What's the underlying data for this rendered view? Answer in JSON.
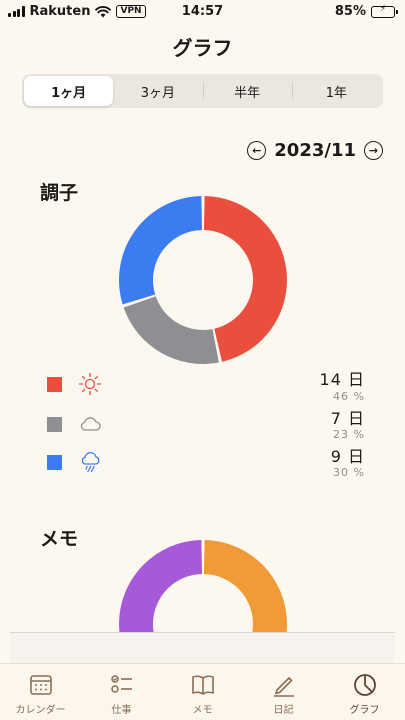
{
  "status_bar": {
    "carrier": "Rakuten",
    "vpn": "VPN",
    "time": "14:57",
    "battery": "85%"
  },
  "title": "グラフ",
  "segments": [
    {
      "label": "1ヶ月",
      "active": true
    },
    {
      "label": "3ヶ月",
      "active": false
    },
    {
      "label": "半年",
      "active": false
    },
    {
      "label": "1年",
      "active": false
    }
  ],
  "month": "2023/11",
  "condition": {
    "title": "調子",
    "chart_data": {
      "type": "pie",
      "categories": [
        "sunny",
        "cloudy",
        "rainy"
      ],
      "values": [
        14,
        7,
        9
      ],
      "colors": [
        "#ea4f3d",
        "#8e8e93",
        "#3b7df0"
      ]
    },
    "legend": [
      {
        "icon": "sun-icon",
        "color": "#ea4f3d",
        "count": "14 日",
        "percent": "46 %"
      },
      {
        "icon": "cloud-icon",
        "color": "#8e8e93",
        "count": "7 日",
        "percent": "23 %"
      },
      {
        "icon": "cloud-rain-icon",
        "color": "#3b7df0",
        "count": "9 日",
        "percent": "30 %"
      }
    ]
  },
  "memo": {
    "title": "メモ",
    "chart_data": {
      "type": "pie",
      "categories": [
        "orange",
        "purple"
      ],
      "values": [
        1,
        1
      ],
      "colors": [
        "#f19a38",
        "#a55bd8"
      ]
    }
  },
  "tabs": [
    {
      "label": "カレンダー",
      "icon": "calendar-icon"
    },
    {
      "label": "仕事",
      "icon": "checklist-icon"
    },
    {
      "label": "メモ",
      "icon": "book-icon"
    },
    {
      "label": "日記",
      "icon": "pencil-icon"
    },
    {
      "label": "グラフ",
      "icon": "chart-icon",
      "active": true
    }
  ]
}
